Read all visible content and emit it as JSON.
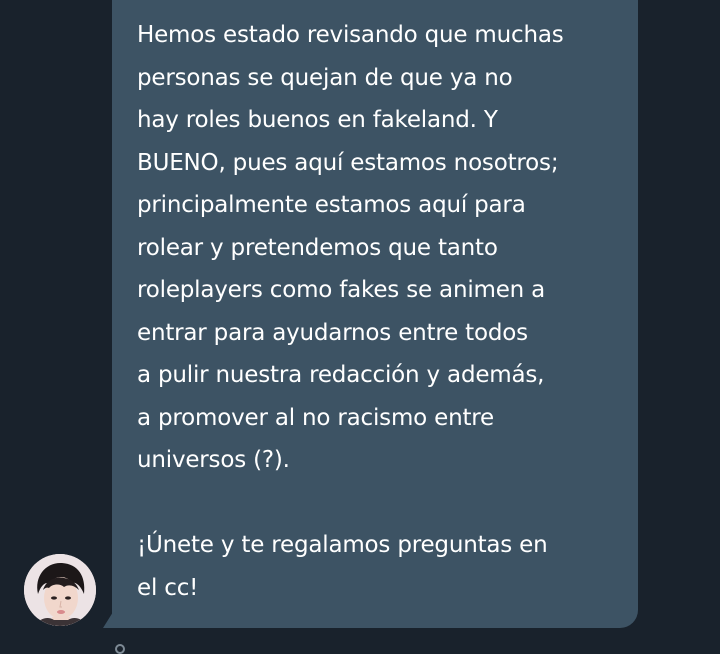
{
  "message": {
    "sender_avatar_icon": "user-avatar",
    "lines": [
      "Hemos estado revisando que muchas",
      "personas se quejan de que ya no",
      "hay roles buenos en fakeland. Y",
      "BUENO, pues aquí estamos nosotros;",
      "principalmente estamos aquí para",
      "rolear y pretendemos que tanto",
      "roleplayers como fakes se animen a",
      "entrar para ayudarnos entre todos",
      "a pulir nuestra redacción y además,",
      "a promover al no racismo entre",
      "universos (?).",
      "",
      "¡Únete y te regalamos preguntas en",
      "el cc!"
    ]
  },
  "colors": {
    "background": "#19222c",
    "bubble": "#3d5364",
    "text": "#ffffff"
  }
}
